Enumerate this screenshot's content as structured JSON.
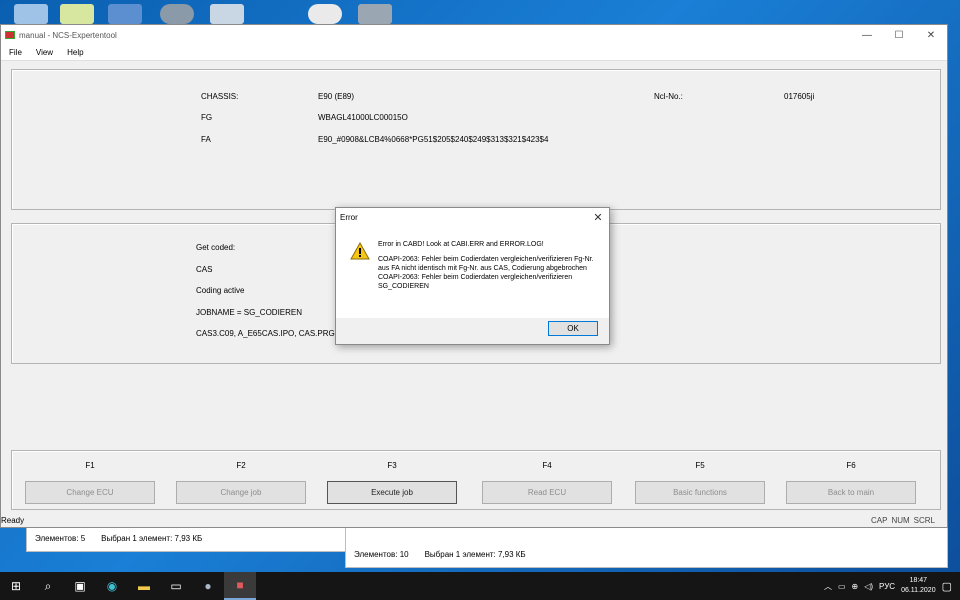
{
  "window": {
    "title": "manual - NCS-Expertentool",
    "controls": {
      "minimize": "—",
      "maximize": "☐",
      "close": "✕"
    }
  },
  "menu": {
    "file": "File",
    "view": "View",
    "help": "Help"
  },
  "vehicle": {
    "chassis_label": "CHASSIS:",
    "chassis_value": "E90 (E89)",
    "fg_label": "FG",
    "fg_value": "WBAGL41000LC00015O",
    "fa_label": "FA",
    "fa_value": "E90_#0908&LCB4%0668*PG51$205$240$249$313$321$423$4",
    "ncl_label": "Ncl-No.:",
    "ncl_value": "017605ji"
  },
  "job": {
    "get_coded": "Get coded:",
    "ecu": "CAS",
    "mode": "Coding active",
    "jobname": "JOBNAME = SG_CODIEREN",
    "files": "CAS3.C09, A_E65CAS.IPO, CAS.PRG"
  },
  "fkeys": [
    {
      "key": "F1",
      "label": "Change ECU"
    },
    {
      "key": "F2",
      "label": "Change job"
    },
    {
      "key": "F3",
      "label": "Execute job"
    },
    {
      "key": "F4",
      "label": "Read ECU"
    },
    {
      "key": "F5",
      "label": "Basic functions"
    },
    {
      "key": "F6",
      "label": "Back to main"
    }
  ],
  "status": {
    "left": "Ready",
    "cap": "CAP",
    "num": "NUM",
    "scrl": "SCRL"
  },
  "dialog": {
    "title": "Error",
    "line1": "Error in CABD! Look at CABI.ERR and ERROR.LOG!",
    "line2": "COAPI-2063: Fehler beim Codierdaten vergleichen/verifizieren Fg-Nr. aus FA nicht identisch mit Fg-Nr. aus CAS, Codierung abgebrochen",
    "line3": "COAPI-2063: Fehler beim Codierdaten vergleichen/verifizieren SG_CODIEREN",
    "ok": "OK"
  },
  "explorer": {
    "left_count": "Элементов: 5",
    "left_selected": "Выбран 1 элемент: 7,93 КБ",
    "right_count": "Элементов: 10",
    "right_selected": "Выбран 1 элемент: 7,93 КБ"
  },
  "taskbar": {
    "lang": "РУС",
    "time": "18:47",
    "date": "06.11.2020"
  },
  "colors": {
    "desktop": "#0a64b8",
    "taskbar": "#151515",
    "warning": "#f5c518",
    "ok_border": "#0078d7"
  }
}
